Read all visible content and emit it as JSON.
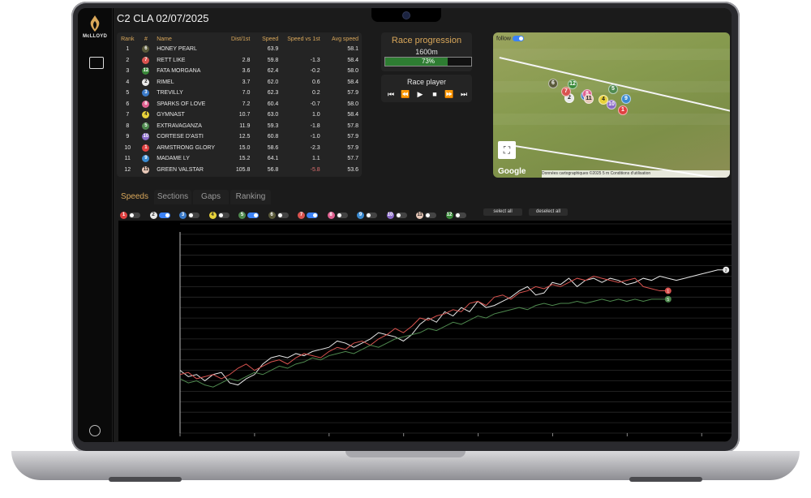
{
  "app": {
    "title": "C2 CLA 02/07/2025",
    "logo_text": "McLLOYD"
  },
  "table": {
    "headers": [
      "Rank",
      "#",
      "Name",
      "Dist/1st",
      "Speed",
      "Speed vs 1st",
      "Avg speed"
    ],
    "rows": [
      {
        "rank": "1",
        "num": "6",
        "name": "HONEY PEARL",
        "dist": "",
        "speed": "63.9",
        "vs": "",
        "avg": "58.1",
        "color": "#5a5a3a"
      },
      {
        "rank": "2",
        "num": "7",
        "name": "RETT LIKE",
        "dist": "2.8",
        "speed": "59.8",
        "vs": "-1.3",
        "avg": "58.4",
        "color": "#d9534f"
      },
      {
        "rank": "3",
        "num": "12",
        "name": "FATA MORGANA",
        "dist": "3.6",
        "speed": "62.4",
        "vs": "-0.2",
        "avg": "58.0",
        "color": "#3a8a3a"
      },
      {
        "rank": "4",
        "num": "2",
        "name": "RIMEL",
        "dist": "3.7",
        "speed": "62.0",
        "vs": "0.6",
        "avg": "58.4",
        "color": "#e8e8e8"
      },
      {
        "rank": "5",
        "num": "3",
        "name": "TREVILLY",
        "dist": "7.0",
        "speed": "62.3",
        "vs": "0.2",
        "avg": "57.9",
        "color": "#3a7ac8"
      },
      {
        "rank": "6",
        "num": "8",
        "name": "SPARKS OF LOVE",
        "dist": "7.2",
        "speed": "60.4",
        "vs": "-0.7",
        "avg": "58.0",
        "color": "#e06090"
      },
      {
        "rank": "7",
        "num": "4",
        "name": "GYMNAST",
        "dist": "10.7",
        "speed": "63.0",
        "vs": "1.0",
        "avg": "58.4",
        "color": "#e8d23a"
      },
      {
        "rank": "8",
        "num": "5",
        "name": "EXTRAVAGANZA",
        "dist": "11.9",
        "speed": "59.3",
        "vs": "-1.8",
        "avg": "57.8",
        "color": "#4f8a4f"
      },
      {
        "rank": "9",
        "num": "10",
        "name": "CORTESE D'ASTI",
        "dist": "12.5",
        "speed": "60.8",
        "vs": "-1.0",
        "avg": "57.9",
        "color": "#8a6ac8"
      },
      {
        "rank": "10",
        "num": "1",
        "name": "ARMSTRONG GLORY",
        "dist": "15.0",
        "speed": "58.6",
        "vs": "-2.3",
        "avg": "57.9",
        "color": "#e04040"
      },
      {
        "rank": "11",
        "num": "9",
        "name": "MADAME LY",
        "dist": "15.2",
        "speed": "64.1",
        "vs": "1.1",
        "avg": "57.7",
        "color": "#3a8ad0"
      },
      {
        "rank": "12",
        "num": "11",
        "name": "GREEN VALSTAR",
        "dist": "105.8",
        "speed": "56.8",
        "vs": "-5.8",
        "avg": "53.6",
        "color": "#e8c8b8"
      }
    ]
  },
  "progression": {
    "title": "Race progression",
    "distance": "1600m",
    "percent_label": "73%",
    "percent": 0.73
  },
  "player": {
    "title": "Race player"
  },
  "map": {
    "follow_label": "follow",
    "google_label": "Google",
    "attribution": "Données cartographiques ©2025    5 m    Conditions d'utilisation"
  },
  "tabs": [
    "Speeds",
    "Sections",
    "Gaps",
    "Ranking"
  ],
  "runners": [
    {
      "num": "1",
      "color": "#e04040",
      "on": false
    },
    {
      "num": "2",
      "color": "#e8e8e8",
      "on": true
    },
    {
      "num": "3",
      "color": "#3a7ac8",
      "on": false
    },
    {
      "num": "4",
      "color": "#e8d23a",
      "on": false
    },
    {
      "num": "5",
      "color": "#4f8a4f",
      "on": true
    },
    {
      "num": "6",
      "color": "#5a5a3a",
      "on": false
    },
    {
      "num": "7",
      "color": "#d9534f",
      "on": true
    },
    {
      "num": "8",
      "color": "#e06090",
      "on": false
    },
    {
      "num": "9",
      "color": "#3a8ad0",
      "on": false
    },
    {
      "num": "10",
      "color": "#8a6ac8",
      "on": false
    },
    {
      "num": "11",
      "color": "#e8c8b8",
      "on": false
    },
    {
      "num": "12",
      "color": "#3a8a3a",
      "on": false
    }
  ],
  "buttons": {
    "select_all": "select all",
    "deselect_all": "deselect all"
  },
  "chart_data": {
    "type": "line",
    "x": [
      0,
      1,
      2,
      3,
      4,
      5,
      6,
      7,
      8,
      9,
      10,
      11,
      12,
      13,
      14,
      15,
      16,
      17,
      18,
      19,
      20,
      21,
      22,
      23,
      24,
      25,
      26,
      27,
      28,
      29,
      30,
      31,
      32,
      33,
      34,
      35,
      36,
      37,
      38,
      39,
      40,
      41,
      42,
      43,
      44,
      45,
      46,
      47,
      48,
      49,
      50,
      51,
      52,
      53,
      54,
      55,
      56,
      57,
      58,
      59,
      60,
      61,
      62,
      63,
      64,
      65,
      66
    ],
    "xlim": [
      0,
      160
    ],
    "ylim": [
      0,
      100
    ],
    "series": [
      {
        "label": "2",
        "color": "#e8e8e8",
        "values": [
          30,
          27,
          28,
          25,
          28,
          29,
          24,
          23,
          26,
          28,
          33,
          36,
          37,
          36,
          38,
          37,
          39,
          40,
          41,
          44,
          43,
          41,
          43,
          45,
          48,
          47,
          46,
          44,
          47,
          52,
          55,
          53,
          58,
          56,
          60,
          58,
          63,
          60,
          61,
          63,
          65,
          68,
          70,
          66,
          67,
          72,
          71,
          74,
          70,
          73,
          74,
          72,
          74,
          73,
          71,
          72,
          74,
          73,
          75,
          74,
          73,
          74,
          75,
          76,
          77,
          78,
          78
        ]
      },
      {
        "label": "1",
        "color": "#d9534f",
        "values": [
          28,
          29,
          26,
          27,
          28,
          26,
          28,
          31,
          33,
          30,
          32,
          34,
          35,
          33,
          36,
          38,
          37,
          36,
          39,
          41,
          40,
          43,
          44,
          42,
          45,
          47,
          50,
          48,
          51,
          55,
          54,
          56,
          57,
          59,
          58,
          62,
          63,
          61,
          65,
          66,
          64,
          67,
          68,
          70,
          69,
          71,
          70,
          72,
          74,
          73,
          75,
          74,
          73,
          72,
          73,
          74,
          70,
          69,
          68,
          68
        ]
      },
      {
        "label": "5",
        "color": "#4f8a4f",
        "values": [
          26,
          24,
          25,
          23,
          22,
          24,
          26,
          25,
          27,
          29,
          28,
          30,
          32,
          31,
          33,
          34,
          36,
          35,
          37,
          38,
          39,
          38,
          40,
          42,
          41,
          43,
          45,
          46,
          47,
          48,
          50,
          49,
          51,
          53,
          52,
          54,
          56,
          55,
          57,
          58,
          59,
          60,
          59,
          61,
          62,
          61,
          62,
          62,
          63,
          62,
          63,
          64,
          63,
          64,
          63,
          64,
          63,
          64,
          64,
          64
        ]
      }
    ]
  }
}
